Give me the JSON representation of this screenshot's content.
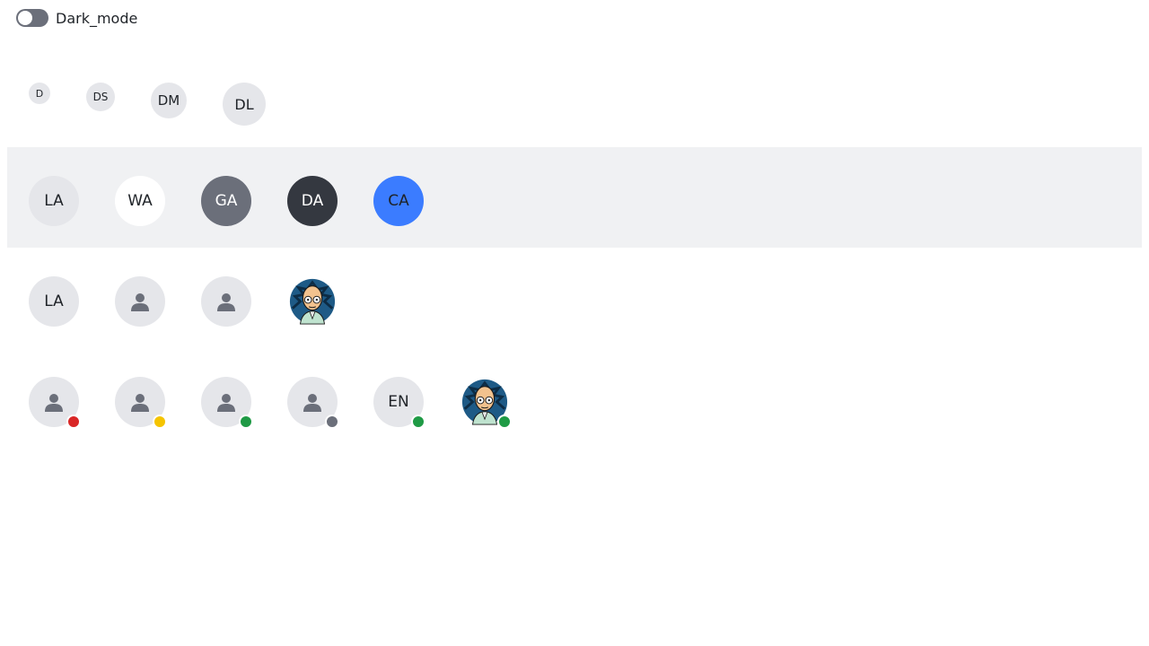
{
  "toggle": {
    "label": "Dark_mode",
    "state": "off"
  },
  "sizes_row": [
    {
      "initials": "D",
      "size": "xs"
    },
    {
      "initials": "DS",
      "size": "sm"
    },
    {
      "initials": "DM",
      "size": "md"
    },
    {
      "initials": "DL",
      "size": "lg"
    }
  ],
  "variants_row": [
    {
      "initials": "LA",
      "variant": "light",
      "bg": "#e5e6ea",
      "fg": "#1f2328"
    },
    {
      "initials": "WA",
      "variant": "white",
      "bg": "#ffffff",
      "fg": "#1f2328"
    },
    {
      "initials": "GA",
      "variant": "grey",
      "bg": "#6b6f7a",
      "fg": "#ffffff"
    },
    {
      "initials": "DA",
      "variant": "dark",
      "bg": "#343840",
      "fg": "#ffffff"
    },
    {
      "initials": "CA",
      "variant": "color",
      "bg": "#3b7cff",
      "fg": "#1f2328"
    }
  ],
  "types_row": [
    {
      "type": "initials",
      "initials": "LA"
    },
    {
      "type": "icon",
      "icon": "person-icon"
    },
    {
      "type": "icon",
      "icon": "person-icon"
    },
    {
      "type": "photo",
      "icon": "professor-photo"
    }
  ],
  "status_row": [
    {
      "type": "icon",
      "icon": "person-icon",
      "status": "busy",
      "status_color": "#d92626"
    },
    {
      "type": "icon",
      "icon": "person-icon",
      "status": "away",
      "status_color": "#f5c400"
    },
    {
      "type": "icon",
      "icon": "person-icon",
      "status": "online",
      "status_color": "#1f9a45"
    },
    {
      "type": "icon",
      "icon": "person-icon",
      "status": "offline",
      "status_color": "#6b6f7a"
    },
    {
      "type": "initials",
      "initials": "EN",
      "status": "online",
      "status_color": "#1f9a45"
    },
    {
      "type": "photo",
      "icon": "professor-photo",
      "status": "online",
      "status_color": "#1f9a45"
    }
  ]
}
